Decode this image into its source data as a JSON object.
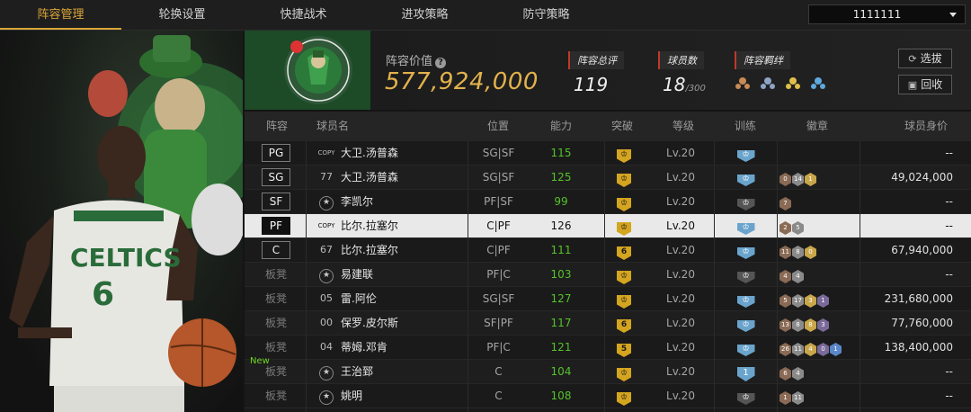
{
  "nav": {
    "tabs": [
      "阵容管理",
      "轮换设置",
      "快捷战术",
      "进攻策略",
      "防守策略"
    ],
    "active_index": 0,
    "account": "1111111"
  },
  "header": {
    "value_label": "阵容价值",
    "value": "577,924,000",
    "rating_label": "阵容总评",
    "rating": "119",
    "count_label": "球员数",
    "count": "18",
    "count_total": "/300",
    "bond_label": "阵容羁绊",
    "bond_icons": [
      "bond-icon-1",
      "bond-icon-2",
      "bond-icon-3",
      "bond-icon-4"
    ],
    "select_button": "选拔",
    "recycle_button": "回收"
  },
  "table": {
    "headers": [
      "阵容",
      "球员名",
      "位置",
      "能力",
      "突破",
      "等级",
      "训练",
      "徽章",
      "球员身价"
    ],
    "rows": [
      {
        "slot": "PG",
        "jersey": "COPY",
        "name": "大卫.汤普森",
        "position": "SG|SF",
        "ability": "115",
        "breakthrough": "",
        "level": "Lv.20",
        "training": "",
        "badges": [],
        "value": "--"
      },
      {
        "slot": "SG",
        "jersey": "77",
        "name": "大卫.汤普森",
        "position": "SG|SF",
        "ability": "125",
        "breakthrough": "",
        "level": "Lv.20",
        "training": "",
        "badges": [
          "0",
          "14",
          "1"
        ],
        "value": "49,024,000"
      },
      {
        "slot": "SF",
        "jersey": "star",
        "name": "李凯尔",
        "position": "PF|SF",
        "ability": "99",
        "breakthrough": "",
        "level": "Lv.20",
        "training": "",
        "badges": [
          "7"
        ],
        "value": "--"
      },
      {
        "slot": "PF",
        "jersey": "COPY",
        "name": "比尔.拉塞尔",
        "position": "C|PF",
        "ability": "126",
        "breakthrough": "",
        "level": "Lv.20",
        "training": "",
        "badges": [
          "2",
          "5"
        ],
        "value": "--"
      },
      {
        "slot": "C",
        "jersey": "67",
        "name": "比尔.拉塞尔",
        "position": "C|PF",
        "ability": "111",
        "breakthrough": "6",
        "level": "Lv.20",
        "training": "",
        "badges": [
          "11",
          "8",
          "0"
        ],
        "value": "67,940,000"
      },
      {
        "slot": "板凳",
        "jersey": "star",
        "name": "易建联",
        "position": "PF|C",
        "ability": "103",
        "breakthrough": "",
        "level": "Lv.20",
        "training": "",
        "badges": [
          "4",
          "4"
        ],
        "value": "--"
      },
      {
        "slot": "板凳",
        "jersey": "05",
        "name": "雷.阿伦",
        "position": "SG|SF",
        "ability": "127",
        "breakthrough": "",
        "level": "Lv.20",
        "training": "",
        "badges": [
          "5",
          "17",
          "3",
          "1"
        ],
        "value": "231,680,000"
      },
      {
        "slot": "板凳",
        "jersey": "00",
        "name": "保罗.皮尔斯",
        "position": "SF|PF",
        "ability": "117",
        "breakthrough": "6",
        "level": "Lv.20",
        "training": "",
        "badges": [
          "13",
          "8",
          "8",
          "3"
        ],
        "value": "77,760,000"
      },
      {
        "slot": "板凳",
        "jersey": "04",
        "name": "蒂姆.邓肯",
        "position": "PF|C",
        "ability": "121",
        "breakthrough": "5",
        "level": "Lv.20",
        "training": "",
        "badges": [
          "26",
          "11",
          "4",
          "0",
          "1"
        ],
        "value": "138,400,000"
      },
      {
        "slot": "板凳",
        "jersey": "star",
        "name": "王治郅",
        "position": "C",
        "ability": "104",
        "breakthrough": "",
        "level": "Lv.20",
        "training": "1",
        "badges": [
          "6",
          "4"
        ],
        "value": "--",
        "new": "New"
      },
      {
        "slot": "板凳",
        "jersey": "star",
        "name": "姚明",
        "position": "C",
        "ability": "108",
        "breakthrough": "",
        "level": "Lv.20",
        "training": "",
        "badges": [
          "1",
          "11"
        ],
        "value": "--"
      }
    ]
  },
  "colors": {
    "accent": "#d9a53a",
    "gold_value": "#e2b24c",
    "ability_green": "#55c22a",
    "training_blue": "#6aa4cc"
  }
}
